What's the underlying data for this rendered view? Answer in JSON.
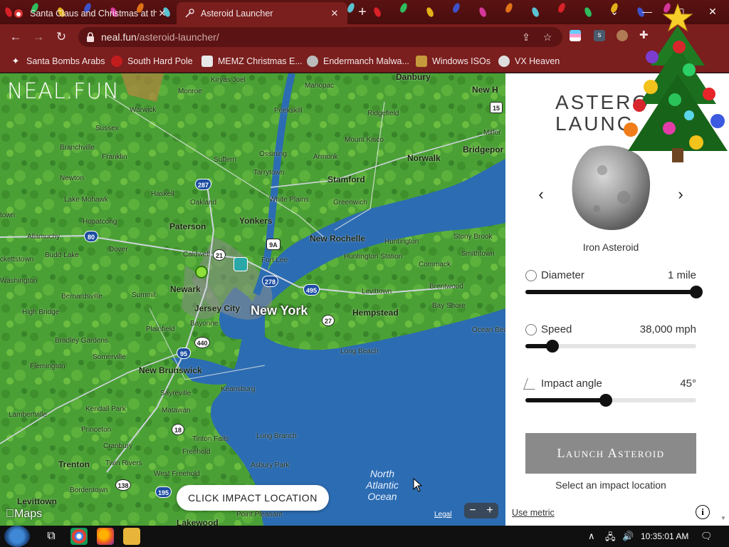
{
  "browser": {
    "tabs": [
      {
        "title": "Santa Claus and Christmas at the",
        "active": false
      },
      {
        "title": "Asteroid Launcher",
        "active": true
      }
    ],
    "new_tab_label": "+",
    "url_host": "neal.fun",
    "url_path": "/asteroid-launcher/",
    "bookmarks": [
      {
        "label": "Santa Bombs Arabs",
        "icon": "globe-icon"
      },
      {
        "label": "South Hard Pole",
        "icon": "ornament-icon"
      },
      {
        "label": "MEMZ Christmas E...",
        "icon": "page-icon"
      },
      {
        "label": "Endermanch Malwa...",
        "icon": "raccoon-icon"
      },
      {
        "label": "Windows ISOs",
        "icon": "figure-icon"
      },
      {
        "label": "VX Heaven",
        "icon": "skull-icon"
      }
    ]
  },
  "map": {
    "logo": "NEAL.FUN",
    "impact_prompt": "CLICK IMPACT LOCATION",
    "attribution": "Maps",
    "legal": "Legal",
    "zoom_out": "−",
    "zoom_in": "+",
    "places": {
      "new_york": "New York",
      "newark": "Newark",
      "yonkers": "Yonkers",
      "paterson": "Paterson",
      "new_rochelle": "New Rochelle",
      "stamford": "Stamford",
      "norwalk": "Norwalk",
      "bridgeport": "Bridgepor",
      "danbury": "Danbury",
      "new_haven": "New H",
      "white_plains": "White Plains",
      "hempstead": "Hempstead",
      "new_brunswick": "New Brunswick",
      "trenton": "Trenton",
      "jersey_city": "Jersey City",
      "long_beach": "Long Beach",
      "long_branch": "Long Branch",
      "asbury_park": "Asbury Park",
      "levittown": "Levittown",
      "levittown_pa": "Levittown",
      "lakewood": "Lakewood",
      "point_pleasant": "Point Pleasant",
      "ocean_1": "North",
      "ocean_2": "Atlantic",
      "ocean_3": "Ocean",
      "mahopac": "Mahopac",
      "peekskill": "Peekskill",
      "ossining": "Ossining",
      "tarrytown": "Tarrytown",
      "monroe": "Monroe",
      "warwick": "Warwick",
      "sussex": "Sussex",
      "franklin": "Franklin",
      "newton": "Newton",
      "branchville": "Branchville",
      "lake_mohawk": "Lake Mohawk",
      "hopatcong": "Hopatcong",
      "dover": "Dover",
      "allamuchy": "Allamuchy",
      "budd_lake": "Budd Lake",
      "washington": "Washington",
      "bernardsville": "Bernardsville",
      "summit": "Summit",
      "plainfield": "Plainfield",
      "bayonne": "Bayonne",
      "high_bridge": "High Bridge",
      "bradley_gardens": "Bradley Gardens",
      "somerville": "Somerville",
      "flemington": "Flemington",
      "sayreville": "Sayreville",
      "keansburg": "Keansburg",
      "matawan": "Matawan",
      "lambertville": "Lambertville",
      "kendall_park": "Kendall Park",
      "princeton": "Princeton",
      "cranbury": "Cranbury",
      "freehold": "Freehold",
      "tinton_falls": "Tinton Falls",
      "twin_rivers": "Twin Rivers",
      "west_freehold": "West Freehold",
      "bordentown": "Bordentown",
      "suffern": "Suffern",
      "haskell": "Haskell",
      "oakland": "Oakland",
      "caldwell": "Caldwell",
      "fort_lee": "Fort Lee",
      "armonk": "Armonk",
      "mount_kisco": "Mount Kisco",
      "ridgefield": "Ridgefield",
      "greenwich": "Greenwich",
      "huntington": "Huntington",
      "huntington_station": "Huntington Station",
      "stony_brook": "Stony Brook",
      "smithtown": "Smithtown",
      "commack": "Commack",
      "brentwood": "Brentwood",
      "bay_shore": "Bay Shore",
      "ocean_beach": "Ocean Beach",
      "milford": "Milfor",
      "kiryas_joel": "Kiryas Joel",
      "eckettstown": "ckettstown",
      "town": "town"
    },
    "shields": [
      "287",
      "80",
      "21",
      "9A",
      "278",
      "495",
      "27",
      "440",
      "95",
      "18",
      "138",
      "195",
      "15"
    ]
  },
  "panel": {
    "title_line1": "ASTERO",
    "title_line2": "LAUNC",
    "asteroid_name": "Iron Asteroid",
    "controls": [
      {
        "label": "Diameter",
        "value": "1 mile",
        "fraction": 1.0,
        "icon": "diameter-icon"
      },
      {
        "label": "Speed",
        "value": "38,000 mph",
        "fraction": 0.16,
        "icon": "speedometer-icon"
      },
      {
        "label": "Impact angle",
        "value": "45°",
        "fraction": 0.47,
        "icon": "angle-icon"
      }
    ],
    "launch_label": "Launch Asteroid",
    "hint": "Select an impact location",
    "metric_link": "Use metric",
    "info_label": "i"
  },
  "taskbar": {
    "clock": "10:35:01 AM"
  },
  "colors": {
    "chrome_dark": "#4a0d0d",
    "chrome": "#7a1e1e",
    "land": "#3f9a2f",
    "water": "#2e6fb4",
    "launch_button": "#8a8a8a"
  }
}
